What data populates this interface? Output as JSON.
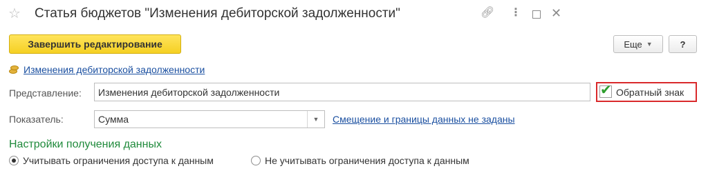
{
  "window": {
    "title": "Статья бюджетов \"Изменения дебиторской задолженности\""
  },
  "toolbar": {
    "finish_editing_label": "Завершить редактирование",
    "more_label": "Еще",
    "help_label": "?"
  },
  "parent": {
    "link_text": "Изменения дебиторской задолженности"
  },
  "form": {
    "representation_label": "Представление:",
    "representation_value": "Изменения дебиторской задолженности",
    "reverse_sign_label": "Обратный знак",
    "reverse_sign_checked": true,
    "indicator_label": "Показатель:",
    "indicator_value": "Сумма",
    "offset_link": "Смещение и границы данных не заданы"
  },
  "data_settings": {
    "title": "Настройки получения данных",
    "options": [
      {
        "label": "Учитывать ограничения доступа к данным",
        "selected": true
      },
      {
        "label": "Не  учитывать ограничения доступа к данным",
        "selected": false
      }
    ]
  },
  "colors": {
    "accent_yellow": "#f5d023",
    "link_blue": "#1a4fa0",
    "section_green": "#1f8a3b",
    "highlight_red": "#d9282a",
    "check_green": "#2e9e2e"
  },
  "icons": [
    "star-icon",
    "link-icon",
    "more-vert-icon",
    "maximize-icon",
    "close-icon",
    "coins-icon",
    "dropdown-icon",
    "checkmark-icon"
  ]
}
